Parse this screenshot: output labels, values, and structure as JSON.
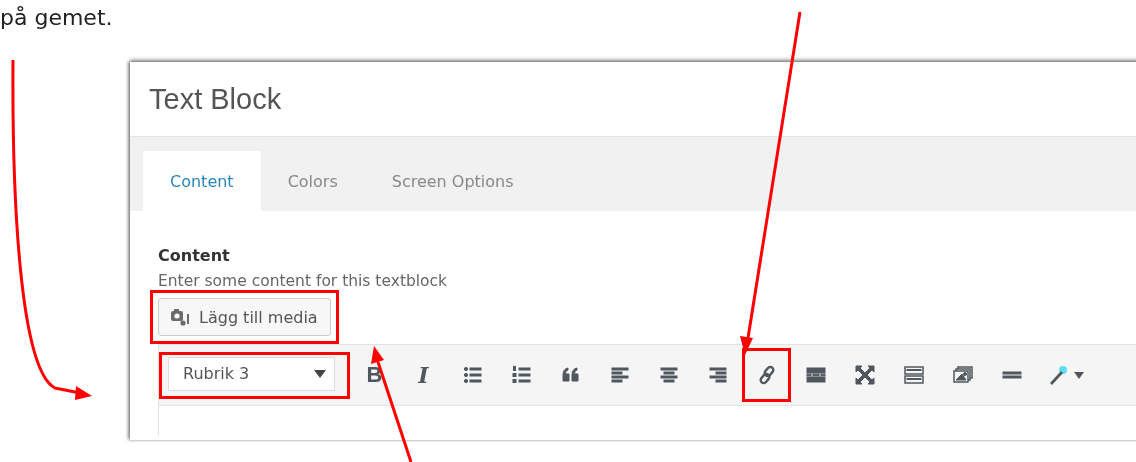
{
  "caption": "på gemet.",
  "window": {
    "title": "Text Block"
  },
  "tabs": [
    {
      "label": "Content",
      "selected": true
    },
    {
      "label": "Colors",
      "selected": false
    },
    {
      "label": "Screen Options",
      "selected": false
    }
  ],
  "field": {
    "label": "Content",
    "description": "Enter some content for this textblock"
  },
  "media_button": {
    "label": "Lägg till media",
    "highlighted": true
  },
  "format_select": {
    "value": "Rubrik 3",
    "highlighted": true
  },
  "toolbar": [
    {
      "kind": "bold",
      "label": "B",
      "highlighted": false
    },
    {
      "kind": "italic",
      "label": "I",
      "highlighted": false
    },
    {
      "kind": "bullet-list",
      "highlighted": false
    },
    {
      "kind": "number-list",
      "highlighted": false
    },
    {
      "kind": "quote",
      "highlighted": false
    },
    {
      "kind": "align-left",
      "highlighted": false
    },
    {
      "kind": "align-center",
      "highlighted": false
    },
    {
      "kind": "align-right",
      "highlighted": false
    },
    {
      "kind": "link",
      "highlighted": true
    },
    {
      "kind": "read-more",
      "highlighted": false
    },
    {
      "kind": "fullscreen",
      "highlighted": false
    },
    {
      "kind": "toolbar-toggle",
      "highlighted": false
    },
    {
      "kind": "gallery",
      "highlighted": false
    },
    {
      "kind": "horizontal-line",
      "highlighted": false
    },
    {
      "kind": "magic-wand",
      "highlighted": false
    }
  ],
  "annotation_arrows": [
    {
      "kind": "curved"
    },
    {
      "kind": "straight"
    },
    {
      "kind": "straight"
    }
  ]
}
